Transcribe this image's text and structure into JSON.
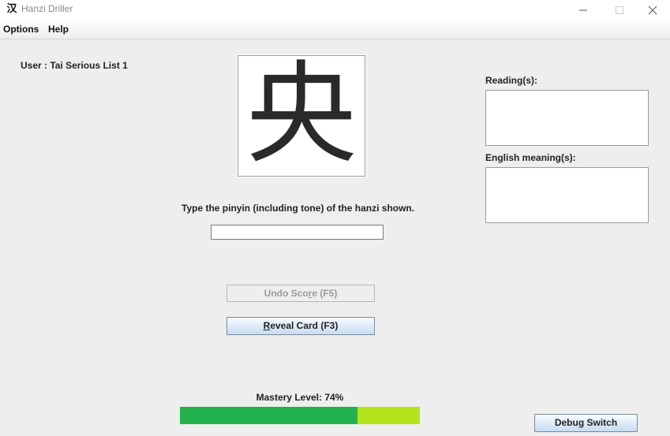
{
  "window": {
    "title": "Hanzi Driller",
    "icon_glyph": "汉"
  },
  "menu": {
    "options": "Options",
    "help": "Help"
  },
  "user": {
    "label": "User : Tai Serious List 1"
  },
  "card": {
    "hanzi": "央"
  },
  "prompt": {
    "text": "Type the pinyin (including tone) of the hanzi shown.",
    "input_value": ""
  },
  "buttons": {
    "undo_prefix": "Undo Sco",
    "undo_mnemonic": "r",
    "undo_suffix": "e (F5)",
    "reveal_mnemonic": "R",
    "reveal_suffix": "eveal Card (F3)",
    "debug": "Debug Switch"
  },
  "right_panel": {
    "readings_label": "Reading(s):",
    "readings_value": "",
    "meaning_label": "English meaning(s):",
    "meaning_value": ""
  },
  "mastery": {
    "label": "Mastery Level: 74%",
    "fraction": 0.74,
    "fill_color": "#22b14c",
    "track_color": "#b4e31c"
  }
}
